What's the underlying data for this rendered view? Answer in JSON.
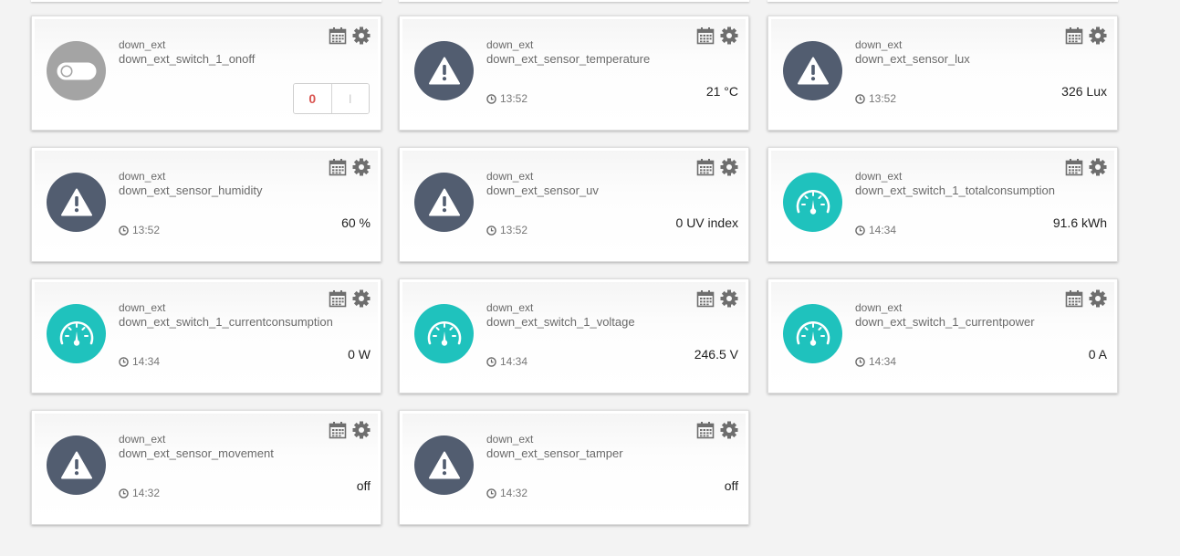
{
  "cards": [
    {
      "type": "down_ext",
      "name": "down_ext_switch_1_onoff",
      "kind": "switch",
      "off_label": "0",
      "on_label": "I"
    },
    {
      "type": "down_ext",
      "name": "down_ext_sensor_temperature",
      "kind": "warn",
      "time": "13:52",
      "value": "21 °C"
    },
    {
      "type": "down_ext",
      "name": "down_ext_sensor_lux",
      "kind": "warn",
      "time": "13:52",
      "value": "326 Lux"
    },
    {
      "type": "down_ext",
      "name": "down_ext_sensor_humidity",
      "kind": "warn",
      "time": "13:52",
      "value": "60 %"
    },
    {
      "type": "down_ext",
      "name": "down_ext_sensor_uv",
      "kind": "warn",
      "time": "13:52",
      "value": "0 UV index"
    },
    {
      "type": "down_ext",
      "name": "down_ext_switch_1_totalconsumption",
      "kind": "meter",
      "time": "14:34",
      "value": "91.6 kWh"
    },
    {
      "type": "down_ext",
      "name": "down_ext_switch_1_currentconsumption",
      "kind": "meter",
      "time": "14:34",
      "value": "0 W"
    },
    {
      "type": "down_ext",
      "name": "down_ext_switch_1_voltage",
      "kind": "meter",
      "time": "14:34",
      "value": "246.5 V"
    },
    {
      "type": "down_ext",
      "name": "down_ext_switch_1_currentpower",
      "kind": "meter",
      "time": "14:34",
      "value": "0 A"
    },
    {
      "type": "down_ext",
      "name": "down_ext_sensor_movement",
      "kind": "warn",
      "time": "14:32",
      "value": "off"
    },
    {
      "type": "down_ext",
      "name": "down_ext_sensor_tamper",
      "kind": "warn",
      "time": "14:32",
      "value": "off"
    }
  ],
  "icons": {
    "calendar": "calendar-icon",
    "settings": "gear-icon",
    "clock": "clock-icon",
    "warning": "warning-triangle-icon",
    "meter": "gauge-icon",
    "switch": "toggle-switch-icon"
  },
  "colors": {
    "warning_avatar": "#525d70",
    "meter_avatar": "#1fc2bd",
    "switch_avatar": "#a4a4a4",
    "off_button_text": "#d9534f"
  }
}
